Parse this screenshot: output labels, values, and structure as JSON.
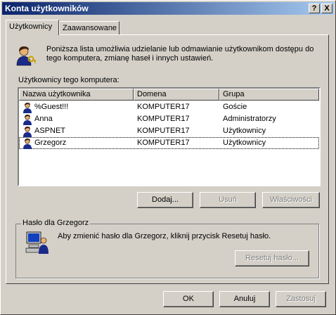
{
  "window": {
    "title": "Konta użytkowników",
    "help_btn": "?",
    "close_btn": "X"
  },
  "tabs": [
    {
      "label": "Użytkownicy",
      "active": true
    },
    {
      "label": "Zaawansowane",
      "active": false
    }
  ],
  "intro": {
    "line1": "Poniższa lista umożliwia udzielanie lub odmawianie użytkownikom dostępu do",
    "line2": "tego komputera, zmianę haseł i innych ustawień."
  },
  "users_label": "Użytkownicy tego komputera:",
  "columns": {
    "name": "Nazwa użytkownika",
    "domain": "Domena",
    "group": "Grupa"
  },
  "users": [
    {
      "name": "%Guest!!!",
      "domain": "KOMPUTER17",
      "group": "Goście"
    },
    {
      "name": "Anna",
      "domain": "KOMPUTER17",
      "group": "Administratorzy"
    },
    {
      "name": "ASPNET",
      "domain": "KOMPUTER17",
      "group": "Użytkownicy"
    },
    {
      "name": "Grzegorz",
      "domain": "KOMPUTER17",
      "group": "Użytkownicy"
    }
  ],
  "buttons": {
    "add": "Dodaj...",
    "remove": "Usuń",
    "properties": "Właściwości"
  },
  "password_group": {
    "label": "Hasło dla Grzegorz",
    "text": "Aby zmienić hasło dla Grzegorz, kliknij przycisk Resetuj hasło.",
    "reset": "Resetuj hasło..."
  },
  "footer": {
    "ok": "OK",
    "cancel": "Anuluj",
    "apply": "Zastosuj"
  }
}
